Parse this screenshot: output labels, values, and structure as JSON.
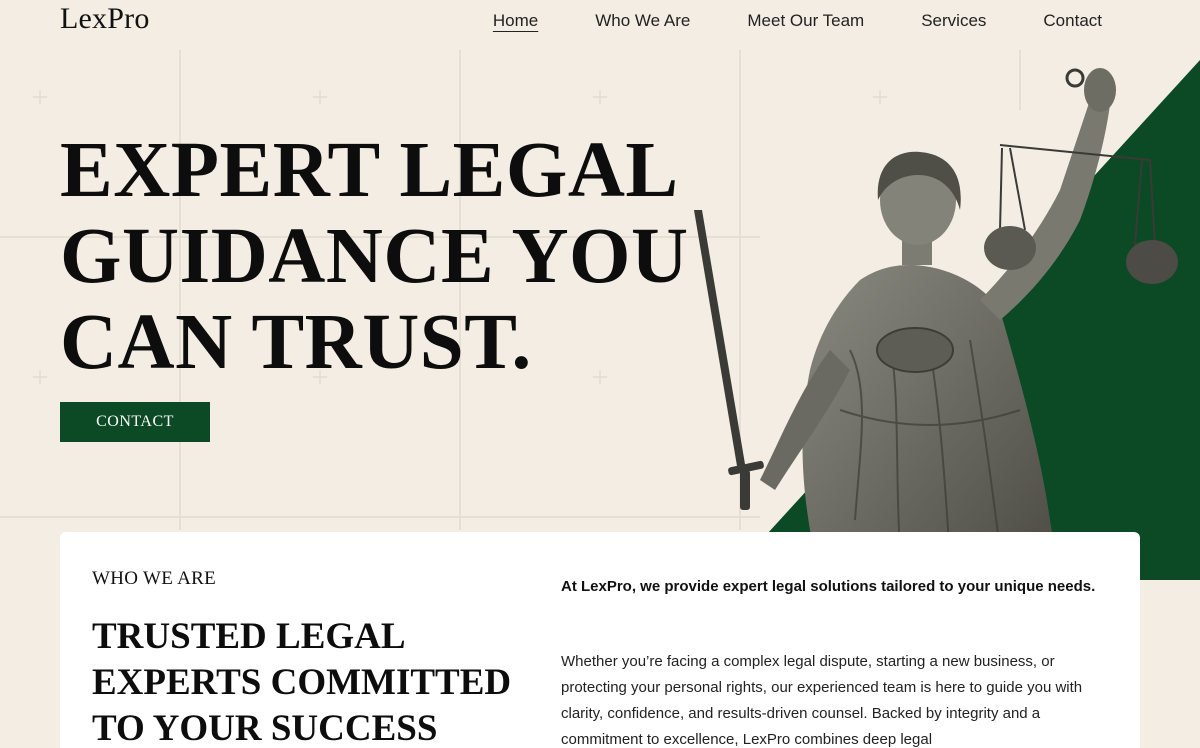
{
  "header": {
    "logo": "LexPro",
    "nav": [
      {
        "label": "Home",
        "active": true
      },
      {
        "label": "Who We Are",
        "active": false
      },
      {
        "label": "Meet Our Team",
        "active": false
      },
      {
        "label": "Services",
        "active": false
      },
      {
        "label": "Contact",
        "active": false
      }
    ]
  },
  "hero": {
    "title_lines": [
      "EXPERT LEGAL",
      "GUIDANCE YOU",
      "CAN TRUST."
    ],
    "cta_label": "CONTACT",
    "art_icon": "lady-justice-statue-icon"
  },
  "about": {
    "eyebrow": "WHO WE ARE",
    "title_lines": [
      "TRUSTED LEGAL",
      "EXPERTS COMMITTED",
      "TO YOUR SUCCESS"
    ],
    "intro": "At LexPro, we provide expert legal solutions tailored to your unique needs.",
    "body": "Whether you’re facing a complex legal dispute, starting a new business, or protecting your personal rights, our experienced team is here to guide you with clarity, confidence, and results-driven counsel. Backed by integrity and a commitment to excellence, LexPro combines deep legal"
  },
  "colors": {
    "background": "#f4ede4",
    "accent_green": "#0b4a24",
    "card": "#ffffff"
  }
}
